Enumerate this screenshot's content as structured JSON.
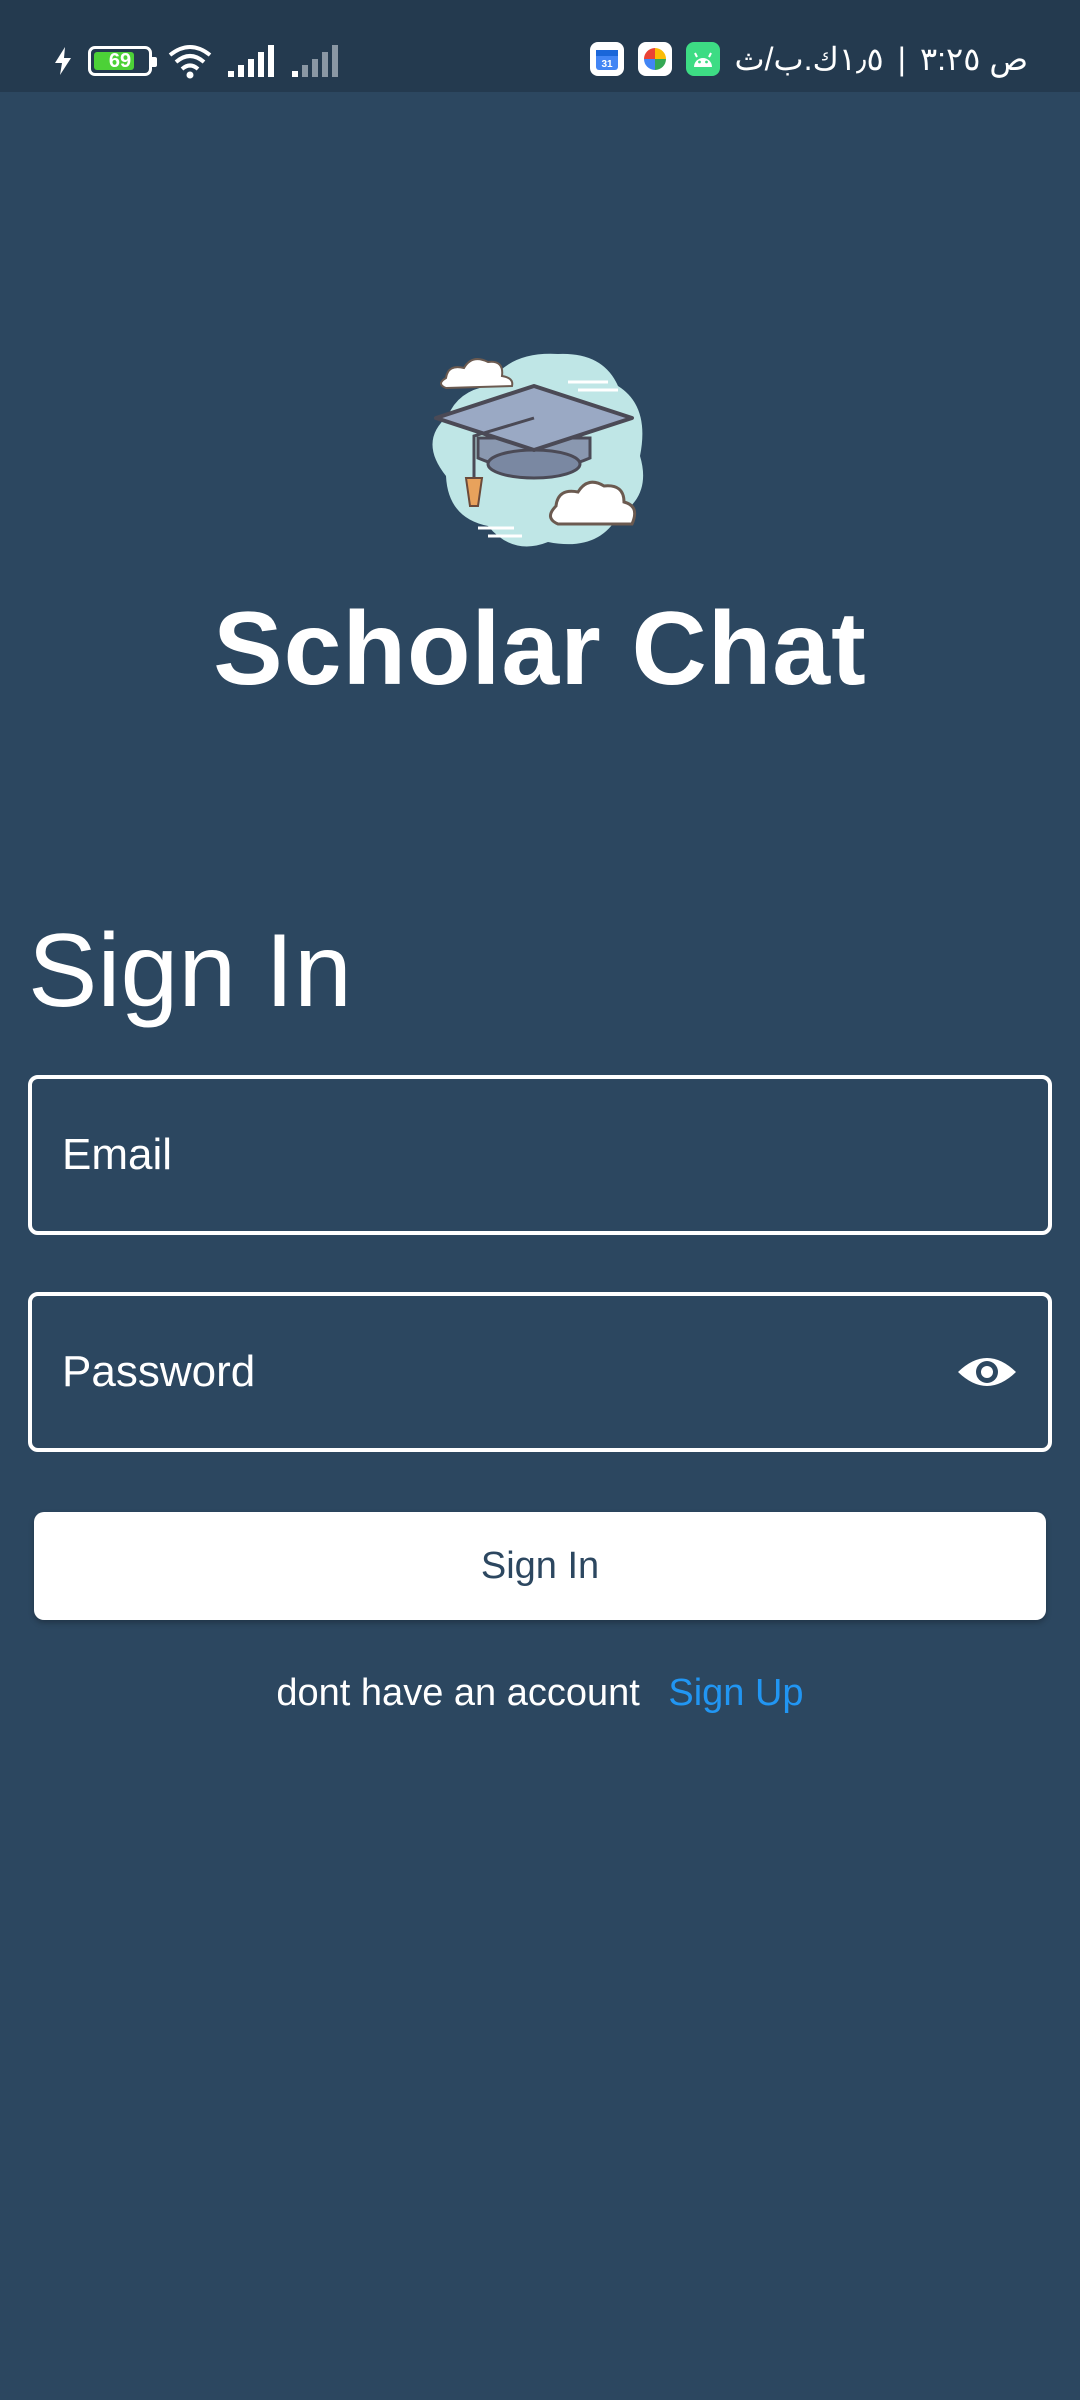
{
  "status_bar": {
    "battery_level": "69",
    "time_text": "ص ٣:٢٥",
    "separator": "|",
    "network_speed": "١٫٥ك.ب/ث",
    "icons": [
      "charging-icon",
      "battery-icon",
      "wifi-icon",
      "signal-strong-icon",
      "signal-weak-icon",
      "android-icon",
      "photos-icon",
      "calendar-icon"
    ]
  },
  "app": {
    "title": "Scholar Chat",
    "logo_icon": "graduation-cap-icon"
  },
  "form": {
    "heading": "Sign In",
    "email_placeholder": "Email",
    "password_placeholder": "Password",
    "visibility_icon": "eye-icon",
    "submit_label": "Sign In",
    "signup_prompt": "dont have an account",
    "signup_link": "Sign Up"
  },
  "colors": {
    "background": "#2c4760",
    "status_bar": "#243a4f",
    "link": "#2196f3",
    "button_bg": "#ffffff",
    "button_text": "#2c4760"
  }
}
